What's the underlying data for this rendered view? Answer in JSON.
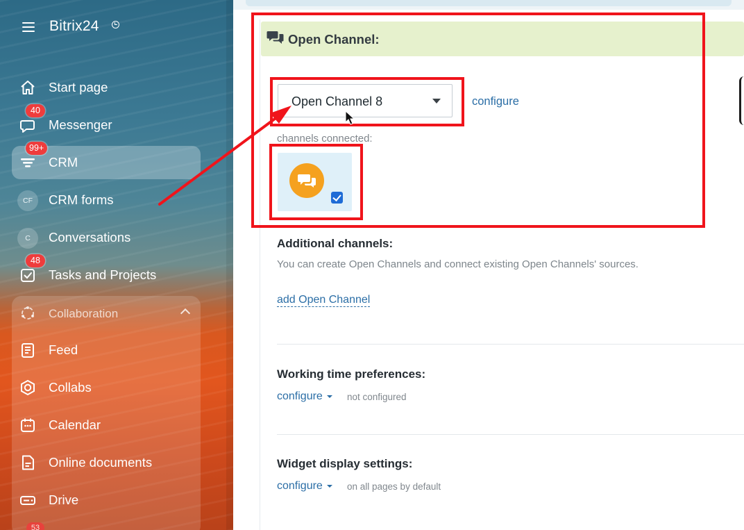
{
  "sidebar": {
    "logo": "Bitrix24",
    "items": [
      {
        "label": "Start page",
        "icon": "home-icon"
      },
      {
        "label": "Messenger",
        "icon": "messenger-icon",
        "badge": "40"
      },
      {
        "label": "CRM",
        "icon": "crm-filter-icon",
        "badge": "99+",
        "active": true
      },
      {
        "label": "CRM forms",
        "icon": "cf-circle-icon",
        "letter": "CF"
      },
      {
        "label": "Conversations",
        "icon": "c-circle-icon",
        "letter": "C"
      },
      {
        "label": "Tasks and Projects",
        "icon": "tasks-check-icon",
        "badge": "48"
      }
    ],
    "collaboration": {
      "label": "Collaboration",
      "items": [
        {
          "label": "Feed",
          "icon": "feed-icon"
        },
        {
          "label": "Collabs",
          "icon": "collabs-hexagon-icon"
        },
        {
          "label": "Calendar",
          "icon": "calendar-icon"
        },
        {
          "label": "Online documents",
          "icon": "document-icon"
        },
        {
          "label": "Drive",
          "icon": "drive-icon"
        }
      ],
      "partial_badge": "53"
    }
  },
  "main": {
    "open_channel": {
      "title": "Open Channel:",
      "selected": "Open Channel 8",
      "configure": "configure",
      "channels_connected_label": "channels connected:",
      "channel_checked": true
    },
    "additional": {
      "title": "Additional channels:",
      "description": "You can create Open Channels and connect existing Open Channels' sources.",
      "add_link": "add Open Channel"
    },
    "working_time": {
      "title": "Working time preferences:",
      "configure": "configure",
      "status": "not configured"
    },
    "widget": {
      "title": "Widget display settings:",
      "configure": "configure",
      "status": "on all pages by default"
    }
  },
  "colors": {
    "annotation_red": "#f0141b",
    "link_blue": "#2b6ea6",
    "header_green": "#e6f1cd",
    "channel_orange": "#f5a11f",
    "badge_red": "#ef3c3c"
  }
}
